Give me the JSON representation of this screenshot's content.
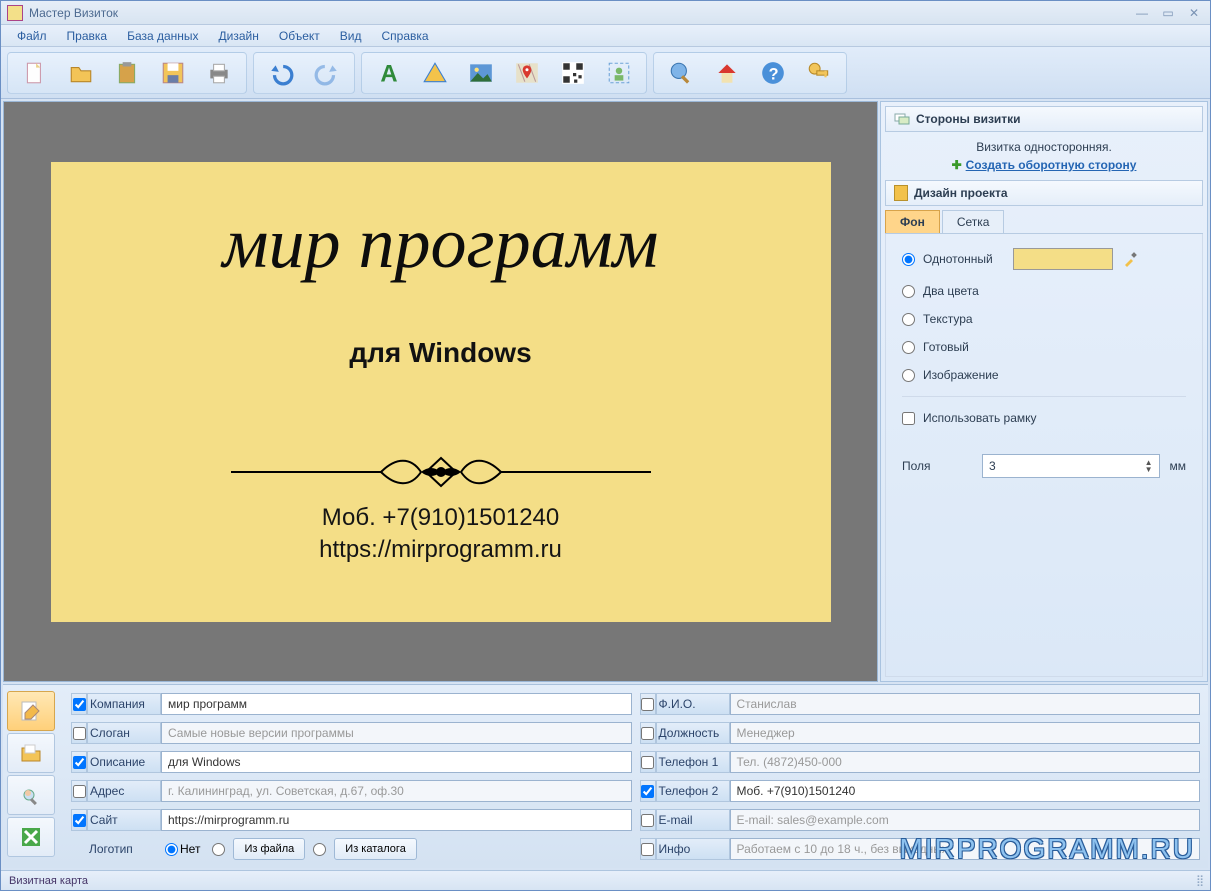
{
  "window": {
    "title": "Мастер Визиток"
  },
  "menu": {
    "items": [
      "Файл",
      "Правка",
      "База данных",
      "Дизайн",
      "Объект",
      "Вид",
      "Справка"
    ]
  },
  "toolbar": {
    "groups": [
      [
        "new-file",
        "open-folder",
        "paste",
        "save",
        "print"
      ],
      [
        "undo",
        "redo"
      ],
      [
        "text",
        "shape",
        "image",
        "map",
        "qrcode",
        "clipart"
      ],
      [
        "search",
        "home",
        "help",
        "key"
      ]
    ]
  },
  "card": {
    "company": "мир программ",
    "desc": "для Windows",
    "phone": "Моб. +7(910)1501240",
    "site": "https://mirprogramm.ru",
    "bg_color": "#f4de87"
  },
  "rpanel": {
    "sides_title": "Стороны визитки",
    "side_info": "Визитка односторонняя.",
    "create_back": "Создать оборотную сторону",
    "design_title": "Дизайн проекта",
    "tabs": {
      "bg": "Фон",
      "grid": "Сетка"
    },
    "bg_options": {
      "solid": "Однотонный",
      "two": "Два цвета",
      "texture": "Текстура",
      "ready": "Готовый",
      "image": "Изображение"
    },
    "use_frame": "Использовать рамку",
    "margins_label": "Поля",
    "margins_value": "3",
    "margins_unit": "мм"
  },
  "form": {
    "left": {
      "company": {
        "label": "Компания",
        "value": "мир программ",
        "on": true
      },
      "slogan": {
        "label": "Слоган",
        "value": "Самые новые версии программы",
        "on": false
      },
      "desc": {
        "label": "Описание",
        "value": "для Windows",
        "on": true
      },
      "address": {
        "label": "Адрес",
        "value": "г. Калининград, ул. Советская, д.67, оф.30",
        "on": false
      },
      "site": {
        "label": "Сайт",
        "value": "https://mirprogramm.ru",
        "on": true
      },
      "logo": {
        "label": "Логотип",
        "none": "Нет",
        "from_file": "Из файла",
        "from_catalog": "Из каталога"
      }
    },
    "right": {
      "fio": {
        "label": "Ф.И.О.",
        "value": "Станислав",
        "on": false
      },
      "pos": {
        "label": "Должность",
        "value": "Менеджер",
        "on": false
      },
      "tel1": {
        "label": "Телефон 1",
        "value": "Тел. (4872)450-000",
        "on": false
      },
      "tel2": {
        "label": "Телефон 2",
        "value": "Моб. +7(910)1501240",
        "on": true
      },
      "email": {
        "label": "E-mail",
        "value": "E-mail: sales@example.com",
        "on": false
      },
      "info": {
        "label": "Инфо",
        "value": "Работаем с 10 до 18 ч., без выходных",
        "on": false
      }
    }
  },
  "status": {
    "text": "Визитная карта"
  },
  "watermark": "MIRPROGRAMM.RU"
}
